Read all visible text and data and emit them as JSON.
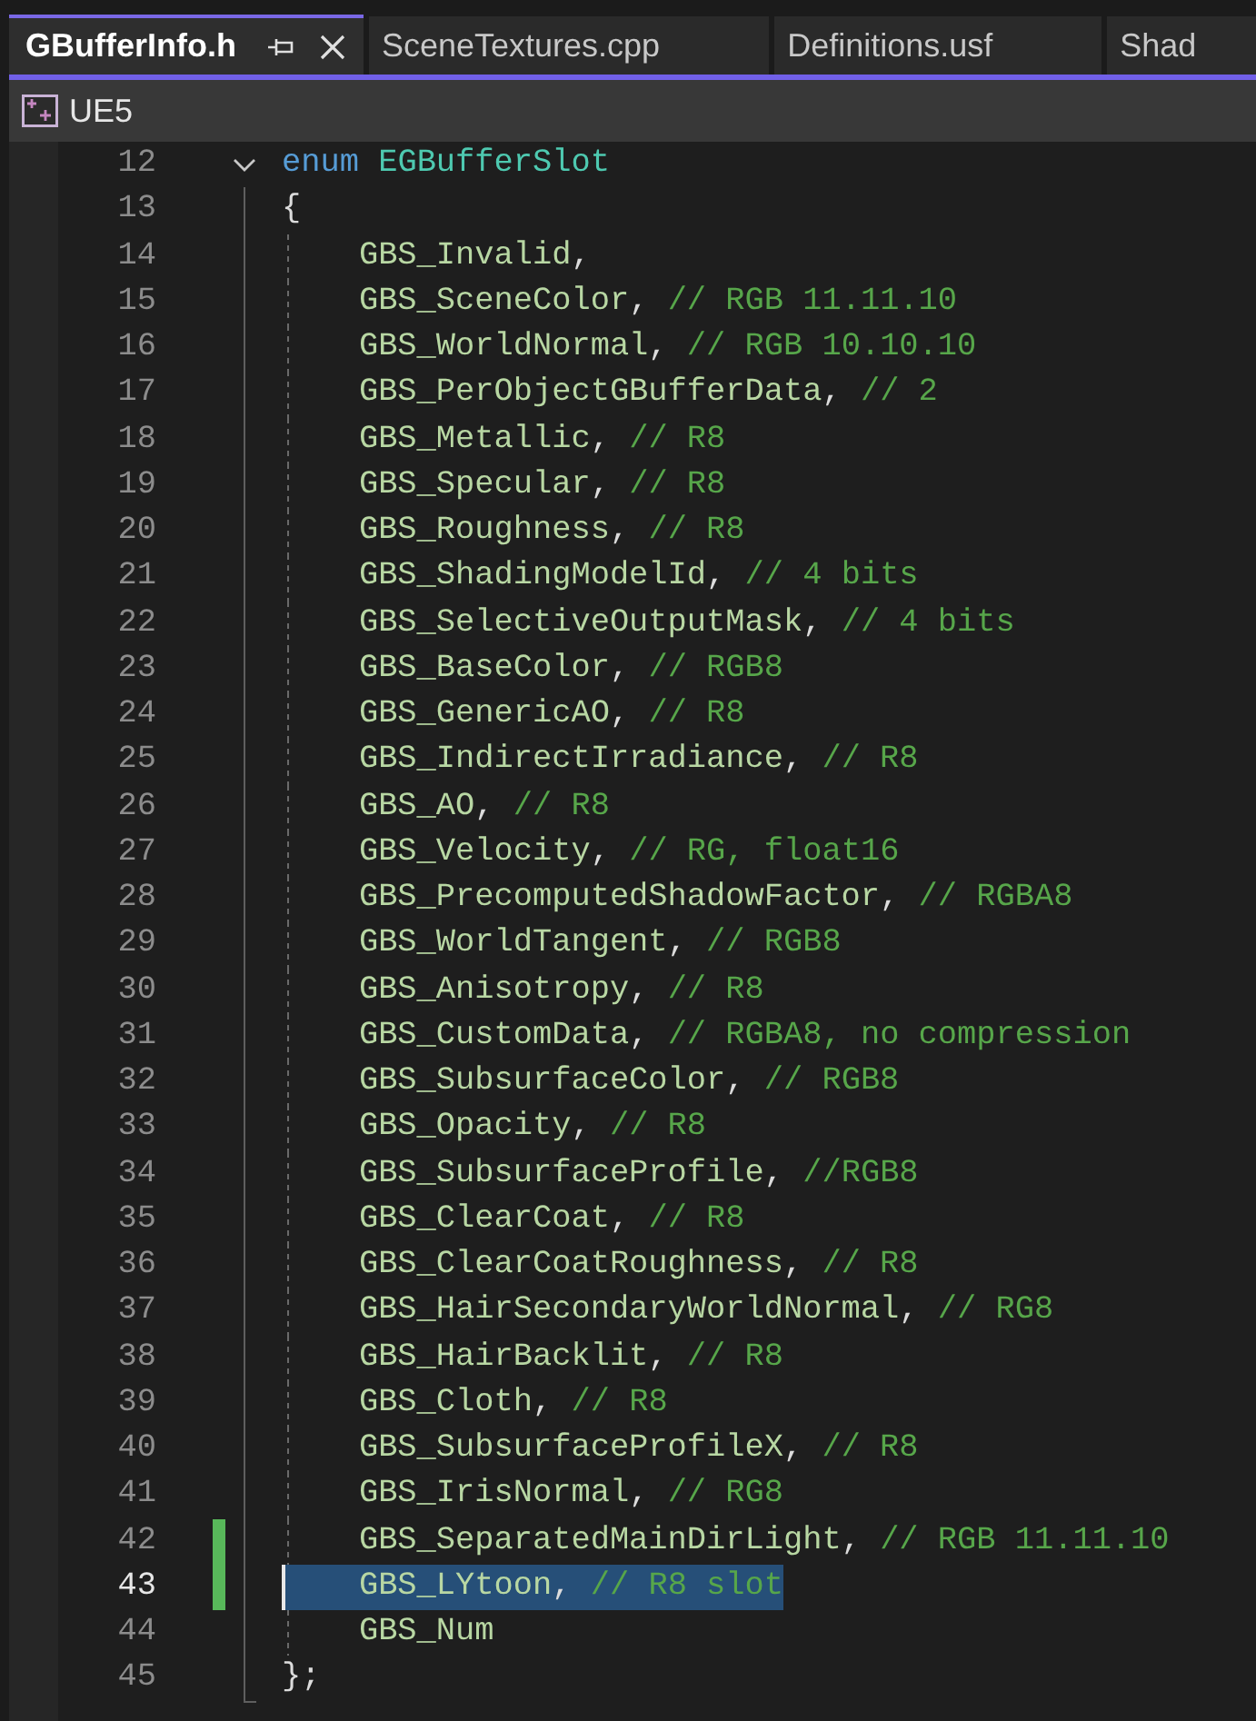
{
  "tabs": [
    {
      "label": "GBufferInfo.h",
      "selected": true
    },
    {
      "label": "SceneTextures.cpp",
      "selected": false
    },
    {
      "label": "Definitions.usf",
      "selected": false
    },
    {
      "label": "Shad",
      "selected": false
    }
  ],
  "navigation_bar": {
    "project": "UE5"
  },
  "editor": {
    "lines": [
      {
        "number": "12",
        "expanded": true,
        "modified": false,
        "selected": false,
        "caret": false,
        "tokens": [
          {
            "kind": "keyword",
            "text": "enum"
          },
          {
            "kind": "type",
            "text": "EGBufferSlot"
          }
        ]
      },
      {
        "number": "13",
        "modified": false,
        "selected": false,
        "caret": false,
        "tokens": [
          {
            "kind": "punctuation",
            "text": "{"
          }
        ],
        "children": [
          {
            "number": "14",
            "modified": false,
            "selected": false,
            "caret": false,
            "tokens": [
              {
                "kind": "enum-member",
                "text": "GBS_Invalid"
              },
              {
                "kind": "punctuation",
                "text": ","
              }
            ]
          },
          {
            "number": "15",
            "modified": false,
            "selected": false,
            "caret": false,
            "tokens": [
              {
                "kind": "enum-member",
                "text": "GBS_SceneColor"
              },
              {
                "kind": "punctuation",
                "text": ","
              },
              {
                "kind": "comment",
                "text": "// RGB 11.11.10"
              }
            ]
          },
          {
            "number": "16",
            "modified": false,
            "selected": false,
            "caret": false,
            "tokens": [
              {
                "kind": "enum-member",
                "text": "GBS_WorldNormal"
              },
              {
                "kind": "punctuation",
                "text": ","
              },
              {
                "kind": "comment",
                "text": "// RGB 10.10.10"
              }
            ]
          },
          {
            "number": "17",
            "modified": false,
            "selected": false,
            "caret": false,
            "tokens": [
              {
                "kind": "enum-member",
                "text": "GBS_PerObjectGBufferData"
              },
              {
                "kind": "punctuation",
                "text": ","
              },
              {
                "kind": "comment",
                "text": "// 2"
              }
            ]
          },
          {
            "number": "18",
            "modified": false,
            "selected": false,
            "caret": false,
            "tokens": [
              {
                "kind": "enum-member",
                "text": "GBS_Metallic"
              },
              {
                "kind": "punctuation",
                "text": ","
              },
              {
                "kind": "comment",
                "text": "// R8"
              }
            ]
          },
          {
            "number": "19",
            "modified": false,
            "selected": false,
            "caret": false,
            "tokens": [
              {
                "kind": "enum-member",
                "text": "GBS_Specular"
              },
              {
                "kind": "punctuation",
                "text": ","
              },
              {
                "kind": "comment",
                "text": "// R8"
              }
            ]
          },
          {
            "number": "20",
            "modified": false,
            "selected": false,
            "caret": false,
            "tokens": [
              {
                "kind": "enum-member",
                "text": "GBS_Roughness"
              },
              {
                "kind": "punctuation",
                "text": ","
              },
              {
                "kind": "comment",
                "text": "// R8"
              }
            ]
          },
          {
            "number": "21",
            "modified": false,
            "selected": false,
            "caret": false,
            "tokens": [
              {
                "kind": "enum-member",
                "text": "GBS_ShadingModelId"
              },
              {
                "kind": "punctuation",
                "text": ","
              },
              {
                "kind": "comment",
                "text": "// 4 bits"
              }
            ]
          },
          {
            "number": "22",
            "modified": false,
            "selected": false,
            "caret": false,
            "tokens": [
              {
                "kind": "enum-member",
                "text": "GBS_SelectiveOutputMask"
              },
              {
                "kind": "punctuation",
                "text": ","
              },
              {
                "kind": "comment",
                "text": "// 4 bits"
              }
            ]
          },
          {
            "number": "23",
            "modified": false,
            "selected": false,
            "caret": false,
            "tokens": [
              {
                "kind": "enum-member",
                "text": "GBS_BaseColor"
              },
              {
                "kind": "punctuation",
                "text": ","
              },
              {
                "kind": "comment",
                "text": "// RGB8"
              }
            ]
          },
          {
            "number": "24",
            "modified": false,
            "selected": false,
            "caret": false,
            "tokens": [
              {
                "kind": "enum-member",
                "text": "GBS_GenericAO"
              },
              {
                "kind": "punctuation",
                "text": ","
              },
              {
                "kind": "comment",
                "text": "// R8"
              }
            ]
          },
          {
            "number": "25",
            "modified": false,
            "selected": false,
            "caret": false,
            "tokens": [
              {
                "kind": "enum-member",
                "text": "GBS_IndirectIrradiance"
              },
              {
                "kind": "punctuation",
                "text": ","
              },
              {
                "kind": "comment",
                "text": "// R8"
              }
            ]
          },
          {
            "number": "26",
            "modified": false,
            "selected": false,
            "caret": false,
            "tokens": [
              {
                "kind": "enum-member",
                "text": "GBS_AO"
              },
              {
                "kind": "punctuation",
                "text": ","
              },
              {
                "kind": "comment",
                "text": "// R8"
              }
            ]
          },
          {
            "number": "27",
            "modified": false,
            "selected": false,
            "caret": false,
            "tokens": [
              {
                "kind": "enum-member",
                "text": "GBS_Velocity"
              },
              {
                "kind": "punctuation",
                "text": ","
              },
              {
                "kind": "comment",
                "text": "// RG, float16"
              }
            ]
          },
          {
            "number": "28",
            "modified": false,
            "selected": false,
            "caret": false,
            "tokens": [
              {
                "kind": "enum-member",
                "text": "GBS_PrecomputedShadowFactor"
              },
              {
                "kind": "punctuation",
                "text": ","
              },
              {
                "kind": "comment",
                "text": "// RGBA8"
              }
            ]
          },
          {
            "number": "29",
            "modified": false,
            "selected": false,
            "caret": false,
            "tokens": [
              {
                "kind": "enum-member",
                "text": "GBS_WorldTangent"
              },
              {
                "kind": "punctuation",
                "text": ","
              },
              {
                "kind": "comment",
                "text": "// RGB8"
              }
            ]
          },
          {
            "number": "30",
            "modified": false,
            "selected": false,
            "caret": false,
            "tokens": [
              {
                "kind": "enum-member",
                "text": "GBS_Anisotropy"
              },
              {
                "kind": "punctuation",
                "text": ","
              },
              {
                "kind": "comment",
                "text": "// R8"
              }
            ]
          },
          {
            "number": "31",
            "modified": false,
            "selected": false,
            "caret": false,
            "tokens": [
              {
                "kind": "enum-member",
                "text": "GBS_CustomData"
              },
              {
                "kind": "punctuation",
                "text": ","
              },
              {
                "kind": "comment",
                "text": "// RGBA8, no compression"
              }
            ]
          },
          {
            "number": "32",
            "modified": false,
            "selected": false,
            "caret": false,
            "tokens": [
              {
                "kind": "enum-member",
                "text": "GBS_SubsurfaceColor"
              },
              {
                "kind": "punctuation",
                "text": ","
              },
              {
                "kind": "comment",
                "text": "// RGB8"
              }
            ]
          },
          {
            "number": "33",
            "modified": false,
            "selected": false,
            "caret": false,
            "tokens": [
              {
                "kind": "enum-member",
                "text": "GBS_Opacity"
              },
              {
                "kind": "punctuation",
                "text": ","
              },
              {
                "kind": "comment",
                "text": "// R8"
              }
            ]
          },
          {
            "number": "34",
            "modified": false,
            "selected": false,
            "caret": false,
            "tokens": [
              {
                "kind": "enum-member",
                "text": "GBS_SubsurfaceProfile"
              },
              {
                "kind": "punctuation",
                "text": ","
              },
              {
                "kind": "comment",
                "text": "//RGB8"
              }
            ]
          },
          {
            "number": "35",
            "modified": false,
            "selected": false,
            "caret": false,
            "tokens": [
              {
                "kind": "enum-member",
                "text": "GBS_ClearCoat"
              },
              {
                "kind": "punctuation",
                "text": ","
              },
              {
                "kind": "comment",
                "text": "// R8"
              }
            ]
          },
          {
            "number": "36",
            "modified": false,
            "selected": false,
            "caret": false,
            "tokens": [
              {
                "kind": "enum-member",
                "text": "GBS_ClearCoatRoughness"
              },
              {
                "kind": "punctuation",
                "text": ","
              },
              {
                "kind": "comment",
                "text": "// R8"
              }
            ]
          },
          {
            "number": "37",
            "modified": false,
            "selected": false,
            "caret": false,
            "tokens": [
              {
                "kind": "enum-member",
                "text": "GBS_HairSecondaryWorldNormal"
              },
              {
                "kind": "punctuation",
                "text": ","
              },
              {
                "kind": "comment",
                "text": "// RG8"
              }
            ]
          },
          {
            "number": "38",
            "modified": false,
            "selected": false,
            "caret": false,
            "tokens": [
              {
                "kind": "enum-member",
                "text": "GBS_HairBacklit"
              },
              {
                "kind": "punctuation",
                "text": ","
              },
              {
                "kind": "comment",
                "text": "// R8"
              }
            ]
          },
          {
            "number": "39",
            "modified": false,
            "selected": false,
            "caret": false,
            "tokens": [
              {
                "kind": "enum-member",
                "text": "GBS_Cloth"
              },
              {
                "kind": "punctuation",
                "text": ","
              },
              {
                "kind": "comment",
                "text": "// R8"
              }
            ]
          },
          {
            "number": "40",
            "modified": false,
            "selected": false,
            "caret": false,
            "tokens": [
              {
                "kind": "enum-member",
                "text": "GBS_SubsurfaceProfileX"
              },
              {
                "kind": "punctuation",
                "text": ","
              },
              {
                "kind": "comment",
                "text": "// R8"
              }
            ]
          },
          {
            "number": "41",
            "modified": false,
            "selected": false,
            "caret": false,
            "tokens": [
              {
                "kind": "enum-member",
                "text": "GBS_IrisNormal"
              },
              {
                "kind": "punctuation",
                "text": ","
              },
              {
                "kind": "comment",
                "text": "// RG8"
              }
            ]
          },
          {
            "number": "42",
            "modified": true,
            "selected": false,
            "caret": false,
            "tokens": [
              {
                "kind": "enum-member",
                "text": "GBS_SeparatedMainDirLight"
              },
              {
                "kind": "punctuation",
                "text": ","
              },
              {
                "kind": "comment",
                "text": "// RGB 11.11.10"
              }
            ]
          },
          {
            "number": "43",
            "modified": true,
            "selected": true,
            "caret": true,
            "tokens": [
              {
                "kind": "enum-member",
                "text": "GBS_LYtoon"
              },
              {
                "kind": "punctuation",
                "text": ","
              },
              {
                "kind": "comment",
                "text": "// R8 slot"
              }
            ]
          },
          {
            "number": "44",
            "modified": false,
            "selected": false,
            "caret": false,
            "tokens": [
              {
                "kind": "enum-member",
                "text": "GBS_Num"
              }
            ]
          }
        ]
      },
      {
        "number": "45",
        "modified": false,
        "selected": false,
        "caret": false,
        "tokens": [
          {
            "kind": "punctuation",
            "text": "};"
          }
        ]
      }
    ]
  }
}
